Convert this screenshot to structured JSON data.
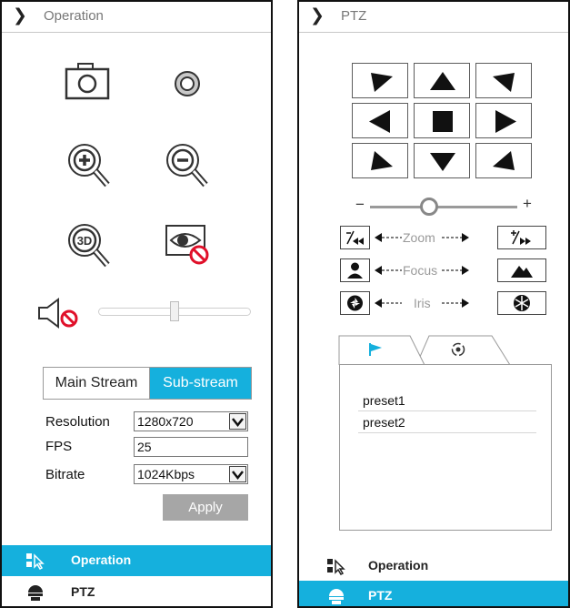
{
  "left_panel": {
    "title": "Operation",
    "icons": [
      "camera-snapshot-icon",
      "record-icon",
      "zoom-in-icon",
      "zoom-out-icon",
      "3d-zoom-icon",
      "eye-privacy-disabled-icon",
      "speaker-muted-icon"
    ],
    "volume": 0.5,
    "stream_tabs": {
      "main": "Main Stream",
      "sub": "Sub-stream",
      "selected": "Sub-stream"
    },
    "form": {
      "resolution_label": "Resolution",
      "resolution_value": "1280x720",
      "fps_label": "FPS",
      "fps_value": "25",
      "bitrate_label": "Bitrate",
      "bitrate_value": "1024Kbps",
      "apply_label": "Apply"
    },
    "nav": [
      {
        "label": "Operation",
        "icon": "operation-icon",
        "active": true
      },
      {
        "label": "PTZ",
        "icon": "ptz-dome-icon",
        "active": false
      }
    ]
  },
  "right_panel": {
    "title": "PTZ",
    "speed_minus": "−",
    "speed_plus": "+",
    "speed": 0.4,
    "zoom_label": "Zoom",
    "focus_label": "Focus",
    "iris_label": "Iris",
    "preset_tab_icon": "flag-icon",
    "cruise_tab_icon": "cruise-icon",
    "presets": [
      "preset1",
      "preset2"
    ],
    "nav": [
      {
        "label": "Operation",
        "icon": "operation-icon",
        "active": false
      },
      {
        "label": "PTZ",
        "icon": "ptz-dome-icon",
        "active": true
      }
    ]
  },
  "colors": {
    "accent": "#15b0dd",
    "apply_button": "#a6a6a6",
    "prohibit_red": "#e0102a"
  }
}
